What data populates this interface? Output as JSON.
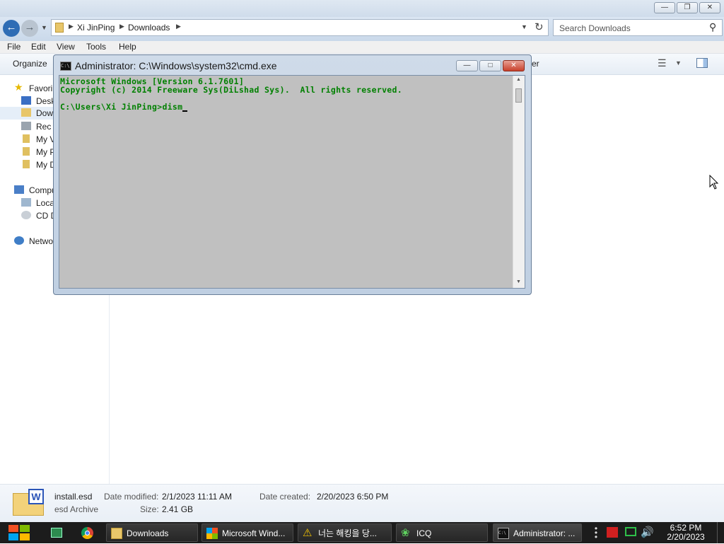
{
  "explorer": {
    "breadcrumb": [
      "Xi JinPing",
      "Downloads"
    ],
    "search_placeholder": "Search Downloads",
    "menu": [
      "File",
      "Edit",
      "View",
      "Tools",
      "Help"
    ],
    "organize_label": "Organize",
    "cut_off_cmd_text": "er",
    "nav": {
      "favorites": "Favori",
      "desktop": "Desk",
      "downloads": "Dow",
      "recent": "Rec",
      "my_videos": "My V",
      "my_pictures": "My P",
      "my_documents": "My D",
      "computer": "Compu",
      "local_disk": "Loca",
      "cd_drive": "CD D",
      "network": "Netwo"
    },
    "details": {
      "filename": "install.esd",
      "filetype": "esd Archive",
      "date_modified_label": "Date modified:",
      "date_modified": "2/1/2023 11:11 AM",
      "size_label": "Size:",
      "size": "2.41 GB",
      "date_created_label": "Date created:",
      "date_created": "2/20/2023 6:50 PM"
    }
  },
  "cmd": {
    "title": "Administrator: C:\\Windows\\system32\\cmd.exe",
    "lines": [
      "Microsoft Windows [Version 6.1.7601]",
      "Copyright (c) 2014 Freeware Sys(DiLshad Sys).  All rights reserved.",
      "",
      "C:\\Users\\Xi JinPing>dism"
    ]
  },
  "taskbar": {
    "items": [
      "Downloads",
      "Microsoft Wind...",
      "너는 해킹을 당...",
      "ICQ",
      "Administrator: ..."
    ],
    "time": "6:52 PM",
    "date": "2/20/2023"
  },
  "colors": {
    "console_text": "#008000",
    "console_bg": "#c0c0c0",
    "taskbar_bg": "#1c1c1c"
  }
}
